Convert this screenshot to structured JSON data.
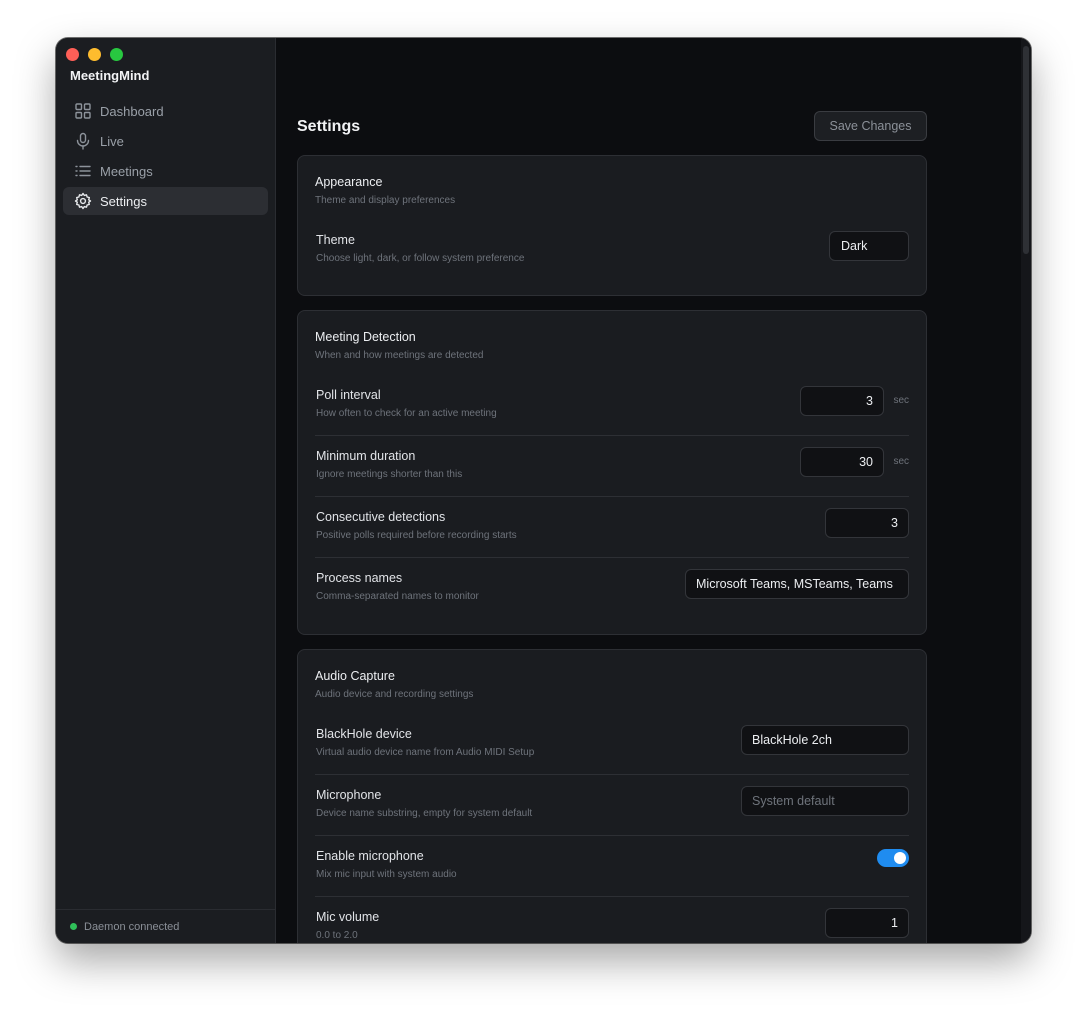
{
  "app": {
    "title": "MeetingMind"
  },
  "sidebar": {
    "items": [
      {
        "label": "Dashboard",
        "icon": "grid-icon"
      },
      {
        "label": "Live",
        "icon": "microphone-icon"
      },
      {
        "label": "Meetings",
        "icon": "list-icon"
      },
      {
        "label": "Settings",
        "icon": "gear-icon",
        "active": true
      }
    ],
    "footer": {
      "status": "Daemon connected",
      "status_color": "#2fbf59"
    }
  },
  "header": {
    "title": "Settings",
    "save_label": "Save Changes"
  },
  "appearance": {
    "title": "Appearance",
    "subtitle": "Theme and display preferences",
    "theme": {
      "label": "Theme",
      "desc": "Choose light, dark, or follow system preference",
      "value": "Dark"
    }
  },
  "detection": {
    "title": "Meeting Detection",
    "subtitle": "When and how meetings are detected",
    "poll": {
      "label": "Poll interval",
      "desc": "How often to check for an active meeting",
      "value": "3",
      "unit": "sec"
    },
    "min_duration": {
      "label": "Minimum duration",
      "desc": "Ignore meetings shorter than this",
      "value": "30",
      "unit": "sec"
    },
    "consecutive": {
      "label": "Consecutive detections",
      "desc": "Positive polls required before recording starts",
      "value": "3"
    },
    "process": {
      "label": "Process names",
      "desc": "Comma-separated names to monitor",
      "value": "Microsoft Teams, MSTeams, Teams"
    }
  },
  "audio": {
    "title": "Audio Capture",
    "subtitle": "Audio device and recording settings",
    "blackhole": {
      "label": "BlackHole device",
      "desc": "Virtual audio device name from Audio MIDI Setup",
      "value": "BlackHole 2ch"
    },
    "microphone": {
      "label": "Microphone",
      "desc": "Device name substring, empty for system default",
      "value": "",
      "placeholder": "System default"
    },
    "enable_mic": {
      "label": "Enable microphone",
      "desc": "Mix mic input with system audio",
      "enabled": true
    },
    "mic_volume": {
      "label": "Mic volume",
      "desc": "0.0 to 2.0",
      "value": "1"
    }
  },
  "colors": {
    "accent": "#1f8cf0",
    "background": "#0c0d10",
    "card": "#1a1c20"
  }
}
